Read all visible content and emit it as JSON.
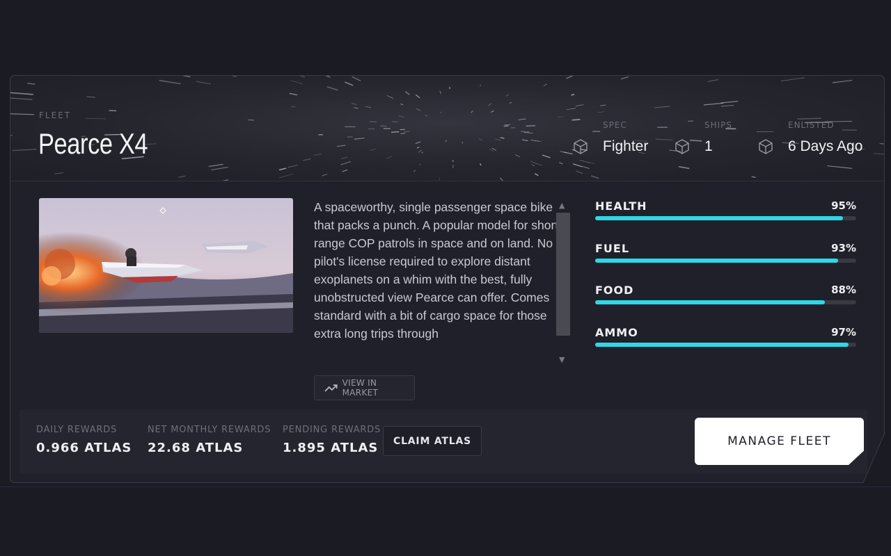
{
  "header": {
    "section_label": "FLEET",
    "fleet_name": "Pearce X4",
    "meta": [
      {
        "label": "SPEC",
        "value": "Fighter",
        "icon": "cube-icon"
      },
      {
        "label": "SHIPS",
        "value": "1",
        "icon": "cube-icon"
      },
      {
        "label": "ENLISTED",
        "value": "6 Days Ago",
        "icon": "cube-icon"
      }
    ]
  },
  "description": "A spaceworthy, single passenger space bike that packs a punch. A popular model for short range COP patrols in space and on land. No pilot's license required to explore distant exoplanets on a whim with the best, fully unobstructed view Pearce can offer. Comes standard with a bit of cargo space for those extra long trips through",
  "market_button": {
    "label": "VIEW IN MARKET",
    "icon": "trending-up-icon"
  },
  "stats": [
    {
      "label": "HEALTH",
      "value": "95%",
      "level": 0.95
    },
    {
      "label": "FUEL",
      "value": "93%",
      "level": 0.93
    },
    {
      "label": "FOOD",
      "value": "88%",
      "level": 0.88
    },
    {
      "label": "AMMO",
      "value": "97%",
      "level": 0.97
    }
  ],
  "rewards": [
    {
      "label": "DAILY REWARDS",
      "value": "0.966 ATLAS"
    },
    {
      "label": "NET MONTHLY REWARDS",
      "value": "22.68 ATLAS"
    },
    {
      "label": "PENDING REWARDS",
      "value": "1.895 ATLAS"
    }
  ],
  "claim_button": "CLAIM ATLAS",
  "manage_button": "MANAGE FLEET",
  "colors": {
    "accent": "#2fd8e6",
    "background": "#1b1b24",
    "card": "#20202a"
  }
}
